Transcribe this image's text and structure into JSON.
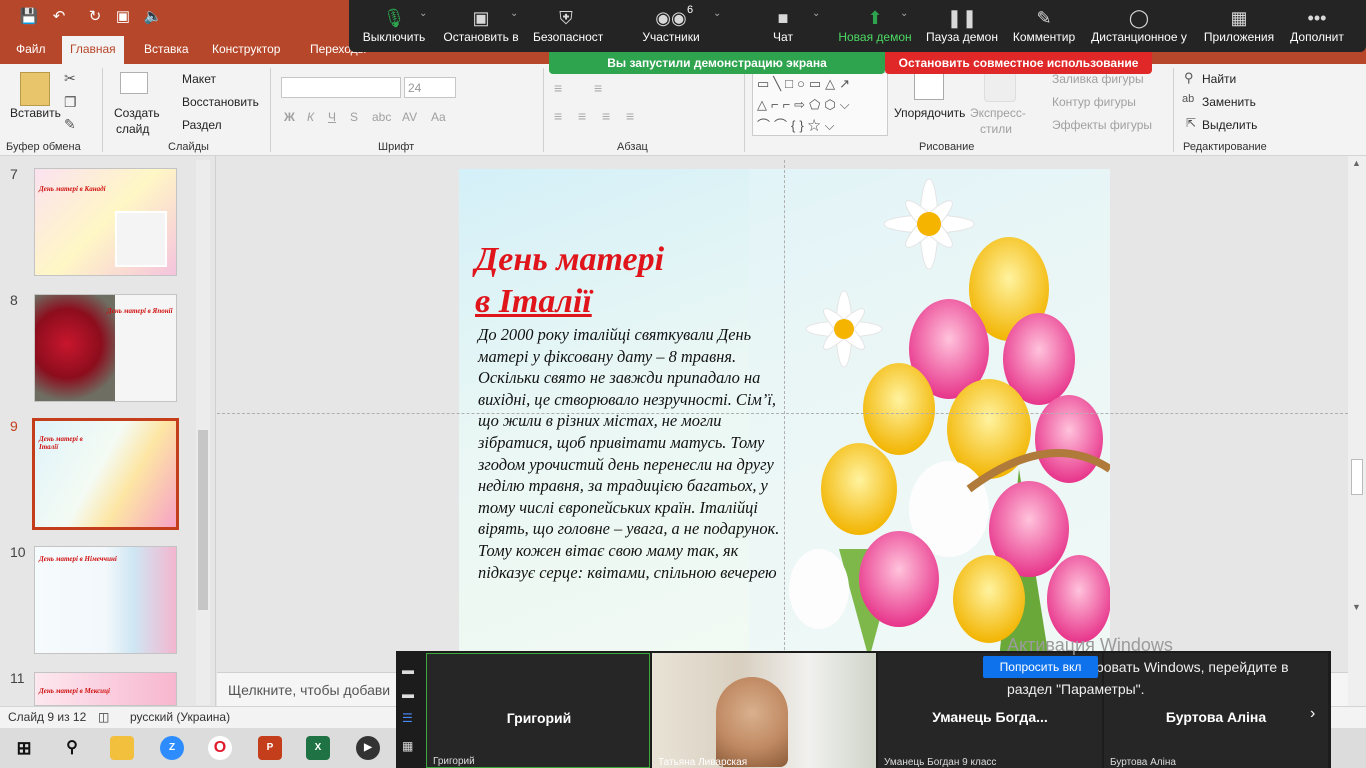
{
  "titlebar": {
    "quick_icons": [
      "save-icon",
      "undo-icon",
      "redo-icon",
      "present-icon",
      "volume-icon"
    ]
  },
  "ribbon_tabs": [
    "Файл",
    "Главная",
    "Вставка",
    "Конструктор",
    "Переходы"
  ],
  "ribbon": {
    "clipboard": {
      "paste": "Вставить",
      "group": "Буфер обмена"
    },
    "slides": {
      "new_slide_l1": "Создать",
      "new_slide_l2": "слайд",
      "layout": "Макет",
      "reset": "Восстановить",
      "section": "Раздел",
      "group": "Слайды"
    },
    "font": {
      "font_size": "24",
      "bold": "Ж",
      "italic": "К",
      "underline": "Ч",
      "strike": "S",
      "shadow": "abc",
      "spacing": "AV",
      "case": "Aa",
      "group": "Шрифт"
    },
    "paragraph": {
      "group": "Абзац"
    },
    "drawing": {
      "arrange": "Упорядочить",
      "quick_styles_l1": "Экспресс-",
      "quick_styles_l2": "стили",
      "fill": "Заливка фигуры",
      "outline": "Контур фигуры",
      "effects": "Эффекты фигуры",
      "group": "Рисование"
    },
    "editing": {
      "find": "Найти",
      "replace": "Заменить",
      "select": "Выделить",
      "group": "Редактирование"
    }
  },
  "zoom_toolbar": {
    "mute": "Выключить",
    "stop_video": "Остановить в",
    "security": "Безопасност",
    "participants": "Участники",
    "participants_count": "6",
    "chat": "Чат",
    "new_share": "Новая демон",
    "pause_share": "Пауза демон",
    "annotate": "Комментир",
    "remote_control": "Дистанционное у",
    "apps": "Приложения",
    "more": "Дополнит"
  },
  "share_banner": {
    "sharing": "Вы запустили демонстрацию экрана",
    "stop": "Остановить совместное использование"
  },
  "thumbnails": [
    {
      "num": "7",
      "title": "День матері в Канаді"
    },
    {
      "num": "8",
      "title": "День матері в Японії"
    },
    {
      "num": "9",
      "title": "День матері в Італії"
    },
    {
      "num": "10",
      "title": "День матері в Німеччині"
    },
    {
      "num": "11",
      "title": "День матері в Мексиці"
    }
  ],
  "slide": {
    "title_line1": "День матері",
    "title_line2": "в Італії",
    "body": "До 2000 року італійці святкували День матері у фіксовану дату – 8 травня. Оскільки свято не завжди припадало на вихідні, це створювало незручності. Сім’ї, що жили в різних містах, не могли зібратися, щоб привітати матусь. Тому згодом урочистий день перенесли на другу неділю травня, за традицією багатьох, у тому числі європейських країн. Італійці вірять, що головне – увага, а не подарунок. Тому кожен вітає свою маму так, як підказує серце: квітами, спільною вечерею"
  },
  "notes_placeholder": "Щелкните, чтобы добави",
  "status": {
    "slide_pos": "Слайд 9 из 12",
    "language": "русский (Украина)"
  },
  "gallery": {
    "tiles": [
      {
        "name": "Григорий",
        "sub": "Григорий"
      },
      {
        "name": "",
        "sub": "Татьяна Ливарская"
      },
      {
        "name": "Уманець  Богда...",
        "sub": "Уманець  Богдан 9 класс"
      },
      {
        "name": "Буртова Аліна",
        "sub": "Буртова Аліна"
      }
    ]
  },
  "windows": {
    "activate_title": "Активация Windows",
    "activate_text": "Чтобы активировать Windows, перейдите в раздел \"Параметры\".",
    "ask_button": "Попросить вкл"
  },
  "taskbar_icons": [
    "windows-start-icon",
    "search-icon",
    "file-explorer-icon",
    "zoom-icon",
    "opera-icon",
    "powerpoint-icon",
    "excel-icon",
    "media-player-icon"
  ],
  "colors": {
    "powerpoint_accent": "#b7472a",
    "title_red": "#e0151b",
    "zoom_green": "#2ea44f",
    "zoom_red": "#e02828"
  }
}
